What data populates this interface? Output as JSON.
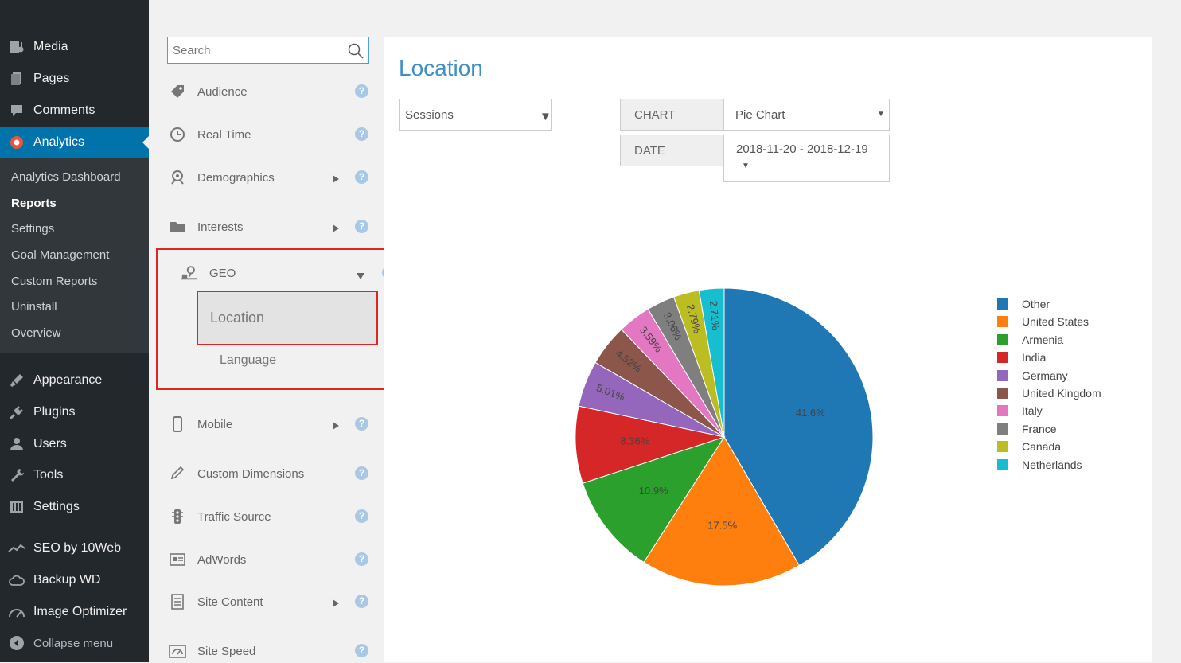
{
  "wp_menu": {
    "items_top": [
      {
        "label": "Media",
        "icon": "media-icon"
      },
      {
        "label": "Pages",
        "icon": "pages-icon"
      },
      {
        "label": "Comments",
        "icon": "comments-icon"
      },
      {
        "label": "Analytics",
        "icon": "analytics-icon"
      }
    ],
    "submenu": [
      "Analytics Dashboard",
      "Reports",
      "Settings",
      "Goal Management",
      "Custom Reports",
      "Uninstall",
      "Overview"
    ],
    "items_bottom": [
      {
        "label": "Appearance",
        "icon": "appearance-icon"
      },
      {
        "label": "Plugins",
        "icon": "plugins-icon"
      },
      {
        "label": "Users",
        "icon": "users-icon"
      },
      {
        "label": "Tools",
        "icon": "tools-icon"
      },
      {
        "label": "Settings",
        "icon": "settings-icon"
      },
      {
        "label": "SEO by 10Web",
        "icon": "seo-icon"
      },
      {
        "label": "Backup WD",
        "icon": "cloud-icon"
      },
      {
        "label": "Image Optimizer",
        "icon": "gauge-icon"
      },
      {
        "label": "Collapse menu",
        "icon": "collapse-icon"
      }
    ]
  },
  "plugin_nav": {
    "search_placeholder": "Search",
    "items": [
      {
        "label": "Audience",
        "icon": "tag-icon",
        "arrow": false
      },
      {
        "label": "Real Time",
        "icon": "clock-icon",
        "arrow": false
      },
      {
        "label": "Demographics",
        "icon": "demographics-icon",
        "arrow": true
      },
      {
        "label": "Interests",
        "icon": "folder-icon",
        "arrow": true
      },
      {
        "label": "GEO",
        "icon": "geo-icon",
        "arrow": true
      },
      {
        "label": "Mobile",
        "icon": "mobile-icon",
        "arrow": true
      },
      {
        "label": "Custom Dimensions",
        "icon": "pen-icon",
        "arrow": false
      },
      {
        "label": "Traffic Source",
        "icon": "traffic-light-icon",
        "arrow": false
      },
      {
        "label": "AdWords",
        "icon": "adwords-icon",
        "arrow": false
      },
      {
        "label": "Site Content",
        "icon": "document-icon",
        "arrow": true
      },
      {
        "label": "Site Speed",
        "icon": "speed-icon",
        "arrow": false
      }
    ],
    "help_symbol": "?",
    "geo_sub": {
      "location": "Location",
      "language": "Language"
    }
  },
  "main": {
    "title": "Location",
    "metric": "Sessions",
    "chart_label": "CHART",
    "chart_value": "Pie Chart",
    "date_label": "DATE",
    "date_value": "2018-11-20 - 2018-12-19"
  },
  "colors": {
    "wp_sidebar": "#23282d",
    "wp_active": "#0073aa",
    "highlight_red": "#e02424",
    "title_blue": "#3f8fc5"
  },
  "chart_data": {
    "type": "pie",
    "categories": [
      "Other",
      "United States",
      "Armenia",
      "India",
      "Germany",
      "United Kingdom",
      "Italy",
      "France",
      "Canada",
      "Netherlands"
    ],
    "values": [
      41.6,
      17.5,
      10.9,
      8.36,
      5.01,
      4.52,
      3.59,
      3.06,
      2.79,
      2.71
    ],
    "labels": [
      "41.6%",
      "17.5%",
      "10.9%",
      "8.36%",
      "5.01%",
      "4.52%",
      "3.59%",
      "3.06%",
      "2.79%",
      "2.71%"
    ],
    "colors": [
      "#1f77b4",
      "#ff7f0e",
      "#2ca02c",
      "#d62728",
      "#9467bd",
      "#8c564b",
      "#e377c2",
      "#7f7f7f",
      "#bcbd22",
      "#17becf"
    ],
    "legend_position": "right"
  }
}
